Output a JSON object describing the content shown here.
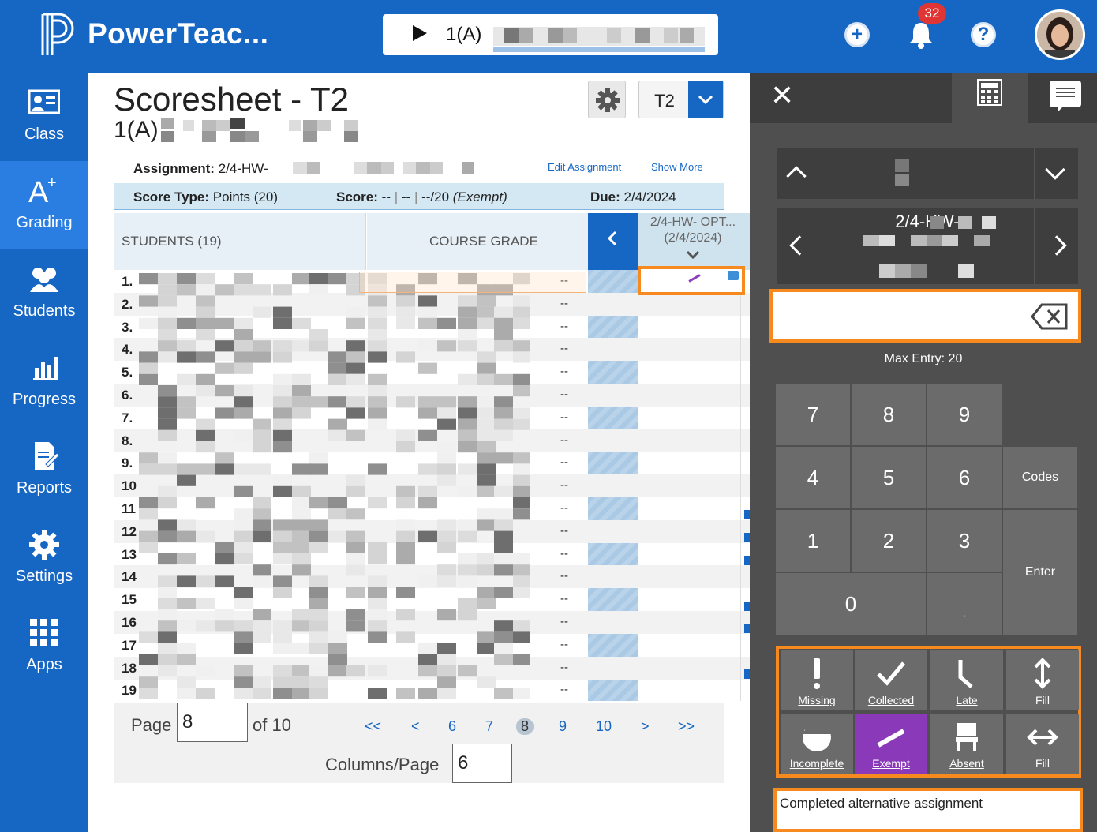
{
  "app": {
    "title": "PowerTeac...",
    "notification_count": "32"
  },
  "class_selector": {
    "label": "1(A)"
  },
  "nav": [
    {
      "label": "Class",
      "icon": "class-icon"
    },
    {
      "label": "Grading",
      "icon": "grading-icon"
    },
    {
      "label": "Students",
      "icon": "students-icon"
    },
    {
      "label": "Progress",
      "icon": "progress-icon"
    },
    {
      "label": "Reports",
      "icon": "reports-icon"
    },
    {
      "label": "Settings",
      "icon": "settings-icon"
    },
    {
      "label": "Apps",
      "icon": "apps-icon"
    }
  ],
  "page": {
    "title": "Scoresheet - T2",
    "subtitle": "1(A)",
    "term": "T2"
  },
  "assignment": {
    "label": "Assignment:",
    "name": "2/4-HW-",
    "edit_link": "Edit Assignment",
    "show_more_link": "Show More",
    "score_type_label": "Score Type:",
    "score_type": "Points (20)",
    "score_label": "Score:",
    "score_value": "--",
    "score_sep": "|",
    "score_value2": "--",
    "score_fraction": "--/20",
    "score_status": "(Exempt)",
    "due_label": "Due:",
    "due": "2/4/2024"
  },
  "grid": {
    "students_header": "STUDENTS (19)",
    "course_header": "COURSE GRADE",
    "assignment_header": "2/4-HW- OPT...",
    "assignment_date": "(2/4/2024)",
    "rows": [
      {
        "num": "1.",
        "grade": "--"
      },
      {
        "num": "2.",
        "grade": "--"
      },
      {
        "num": "3.",
        "grade": "--"
      },
      {
        "num": "4.",
        "grade": "--"
      },
      {
        "num": "5.",
        "grade": "--"
      },
      {
        "num": "6.",
        "grade": "--"
      },
      {
        "num": "7.",
        "grade": "--"
      },
      {
        "num": "8.",
        "grade": "--"
      },
      {
        "num": "9.",
        "grade": "--"
      },
      {
        "num": "10",
        "grade": "--"
      },
      {
        "num": "11",
        "grade": "--"
      },
      {
        "num": "12",
        "grade": "--"
      },
      {
        "num": "13",
        "grade": "--"
      },
      {
        "num": "14",
        "grade": "--"
      },
      {
        "num": "15",
        "grade": "--"
      },
      {
        "num": "16",
        "grade": "--"
      },
      {
        "num": "17",
        "grade": "--"
      },
      {
        "num": "18",
        "grade": "--"
      },
      {
        "num": "19",
        "grade": "--"
      }
    ]
  },
  "pager": {
    "page_label": "Page",
    "page_value": "8",
    "of_label": "of 10",
    "first": "<<",
    "prev": "<",
    "pages": [
      "6",
      "7",
      "8",
      "9",
      "10"
    ],
    "current": "8",
    "next": ">",
    "last": ">>",
    "columns_label": "Columns/Page",
    "columns_value": "6"
  },
  "panel": {
    "assignment_name": "2/4-HW-",
    "max_entry": "Max Entry: 20",
    "keys": [
      "7",
      "8",
      "9",
      "4",
      "5",
      "6",
      "1",
      "2",
      "3",
      "0",
      "."
    ],
    "codes_label": "Codes",
    "enter_label": "Enter",
    "codes": [
      {
        "label": "Missing",
        "icon": "exclamation-icon"
      },
      {
        "label": "Collected",
        "icon": "checkmark-icon"
      },
      {
        "label": "Late",
        "icon": "late-icon"
      },
      {
        "label": "Fill",
        "icon": "vertical-arrows-icon"
      },
      {
        "label": "Incomplete",
        "icon": "half-circle-icon"
      },
      {
        "label": "Exempt",
        "icon": "slash-icon"
      },
      {
        "label": "Absent",
        "icon": "chair-icon"
      },
      {
        "label": "Fill",
        "icon": "horizontal-arrows-icon"
      }
    ],
    "comment": "Completed alternative assignment"
  },
  "colors": {
    "brand": "#1666c4",
    "highlight": "#f68a1f",
    "exempt": "#8a3ab9",
    "panel": "#4f4f4f"
  }
}
